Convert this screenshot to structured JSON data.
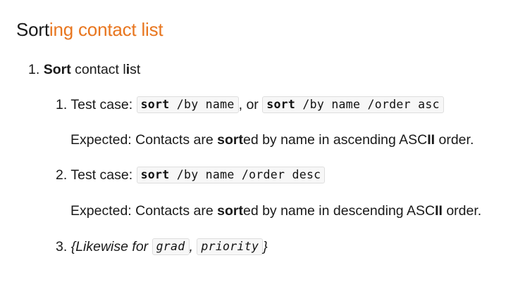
{
  "title": {
    "part1": "Sort",
    "part2": "ing contact list"
  },
  "step1": {
    "number": "1.",
    "bold": "Sort",
    "text": " contact l",
    "bold2": "i",
    "text2": "st"
  },
  "case1": {
    "number": "1.",
    "label": "Test case:",
    "code1_kw": "sort",
    "code1_rest": " /by name",
    "sep": ", or",
    "code2_kw": "sort",
    "code2_rest": " /by name /order asc"
  },
  "expected1": {
    "prefix": "Expected: Contacts are ",
    "bold": "sort",
    "suffix": "ed by name in ascending ASC",
    "bold2": "II",
    "suffix2": " order."
  },
  "case2": {
    "number": "2.",
    "label": "Test case:",
    "code_kw": "sort",
    "code_rest": " /by name /order desc"
  },
  "expected2": {
    "prefix": "Expected: Contacts are ",
    "bold": "sort",
    "suffix": "ed by name in descending ASC",
    "bold2": "II",
    "suffix2": " order."
  },
  "case3": {
    "number": "3.",
    "text": "{Likewise for",
    "code1": "grad",
    "sep": ",",
    "code2": "priority",
    "close": "}"
  }
}
